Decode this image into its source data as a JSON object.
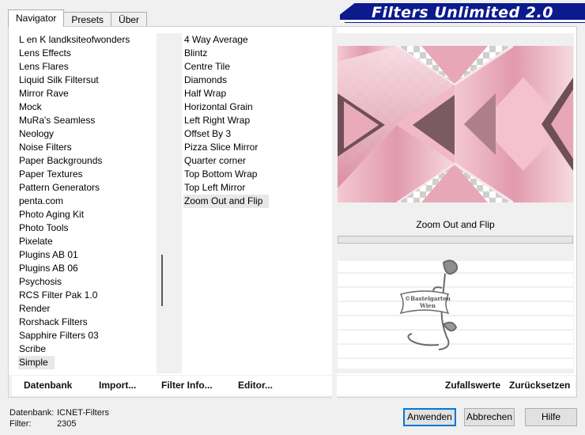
{
  "tabs": [
    {
      "label": "Navigator",
      "active": true
    },
    {
      "label": "Presets",
      "active": false
    },
    {
      "label": "Über",
      "active": false
    }
  ],
  "banner": {
    "title": "Filters Unlimited 2.0"
  },
  "categories": [
    "L en K landksiteofwonders",
    "Lens Effects",
    "Lens Flares",
    "Liquid Silk Filtersut",
    "Mirror Rave",
    "Mock",
    "MuRa's Seamless",
    "Neology",
    "Noise Filters",
    "Paper Backgrounds",
    "Paper Textures",
    "Pattern Generators",
    "penta.com",
    "Photo Aging Kit",
    "Photo Tools",
    "Pixelate",
    "Plugins AB 01",
    "Plugins AB 06",
    "Psychosis",
    "RCS Filter Pak 1.0",
    "Render",
    "Rorshack Filters",
    "Sapphire Filters 03",
    "Scribe",
    "Simple"
  ],
  "selected_category": "Simple",
  "filters": [
    "4 Way Average",
    "Blintz",
    "Centre Tile",
    "Diamonds",
    "Half Wrap",
    "Horizontal Grain",
    "Left Right Wrap",
    "Offset By 3",
    "Pizza Slice Mirror",
    "Quarter corner",
    "Top Bottom Wrap",
    "Top Left Mirror",
    "Zoom Out and Flip"
  ],
  "selected_filter": "Zoom Out and Flip",
  "preview": {
    "filter_name": "Zoom Out and Flip",
    "watermark": "©Bastelgarten Wien"
  },
  "actions": {
    "database": "Datenbank",
    "import": "Import...",
    "filter_info": "Filter Info...",
    "editor": "Editor...",
    "randomize": "Zufallswerte",
    "reset": "Zurücksetzen"
  },
  "status": {
    "database_label": "Datenbank:",
    "database_value": "ICNET-Filters",
    "filter_label": "Filter:",
    "filter_value": "2305"
  },
  "buttons": {
    "apply": "Anwenden",
    "cancel": "Abbrechen",
    "help": "Hilfe"
  },
  "colors": {
    "banner": "#0b1a8c",
    "pink": "#e8a7b6",
    "dark_pink": "#6e4f58"
  }
}
